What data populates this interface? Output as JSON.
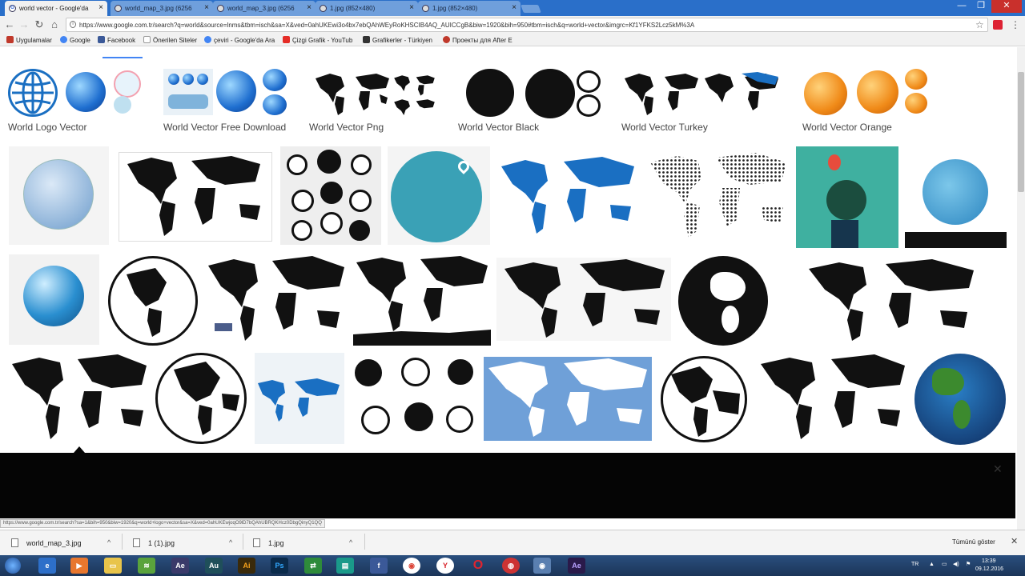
{
  "browser": {
    "tabs": [
      {
        "title": "world vector - Google'da",
        "active": true
      },
      {
        "title": "world_map_3.jpg (6256"
      },
      {
        "title": "world_map_3.jpg (6256"
      },
      {
        "title": "1.jpg (852×480)"
      },
      {
        "title": "1.jpg (852×480)"
      }
    ],
    "url": "https://www.google.com.tr/search?q=world&source=lnms&tbm=isch&sa=X&ved=0ahUKEwi3o4bx7ebQAhWEyRoKHSCIB4AQ_AUICCgB&biw=1920&bih=950#tbm=isch&q=world+vector&imgrc=Kf1YFKS2Lcz5kM%3A",
    "bookmarks": [
      {
        "label": "Uygulamalar",
        "icon": "apps-grid-icon",
        "color": "#c0392b"
      },
      {
        "label": "Google",
        "icon": "google-g-icon",
        "color": "#4285f4"
      },
      {
        "label": "Facebook",
        "icon": "facebook-icon",
        "color": "#3b5998"
      },
      {
        "label": "Önerilen Siteler",
        "icon": "page-icon",
        "color": "#999999"
      },
      {
        "label": "çeviri - Google'da Ara",
        "icon": "google-g-icon",
        "color": "#4285f4"
      },
      {
        "label": "Çizgi Grafik - YouTub",
        "icon": "youtube-icon",
        "color": "#e52d27"
      },
      {
        "label": "Grafikerler - Türkiyen",
        "icon": "flag-icon",
        "color": "#333333"
      },
      {
        "label": "Проекты для After E",
        "icon": "red-circle-icon",
        "color": "#c0392b"
      }
    ]
  },
  "related_searches": [
    {
      "label": "World Logo Vector",
      "theme": "blue"
    },
    {
      "label": "World Vector Free Download",
      "theme": "blue"
    },
    {
      "label": "World Vector Png",
      "theme": "black"
    },
    {
      "label": "World Vector Black",
      "theme": "black"
    },
    {
      "label": "World Vector Turkey",
      "theme": "black"
    },
    {
      "label": "World Vector Orange",
      "theme": "orange"
    }
  ],
  "status_url": "https://www.google.com.tr/search?sa=1&bih=950&biw=1920&q=world+logo+vector&sa=X&ved=0ahUKEwjoqO9lD7bQAhUBRQKHcz0DbgQinyQ1QQ",
  "downloads": [
    {
      "filename": "world_map_3.jpg"
    },
    {
      "filename": "1 (1).jpg"
    },
    {
      "filename": "1.jpg"
    }
  ],
  "show_all_label": "Tümünü göster",
  "tray": {
    "lang": "TR",
    "time": "13:39",
    "date": "09.12.2016"
  },
  "colors": {
    "titlebar": "#2a6fc9",
    "map_blue": "#1a6fc2",
    "map_black": "#111111",
    "teal": "#3aa1b6"
  }
}
